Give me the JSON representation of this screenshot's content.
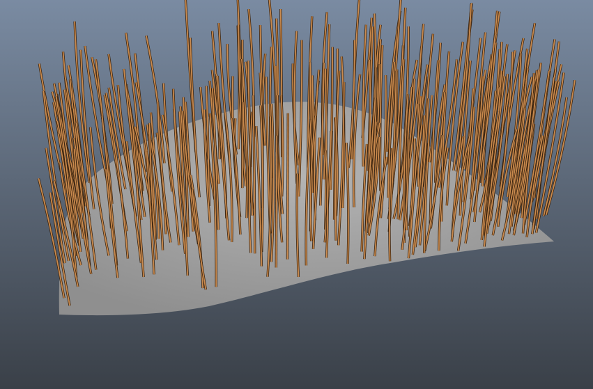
{
  "viewport": {
    "background_top": "#7a8ba2",
    "background_bottom": "#3a4048"
  },
  "scene": {
    "plane_color": "#8f8f8f",
    "plane_highlight": "#b4b4b4",
    "strand_color": "#c98a4e",
    "strand_outline": "#3c2510"
  }
}
